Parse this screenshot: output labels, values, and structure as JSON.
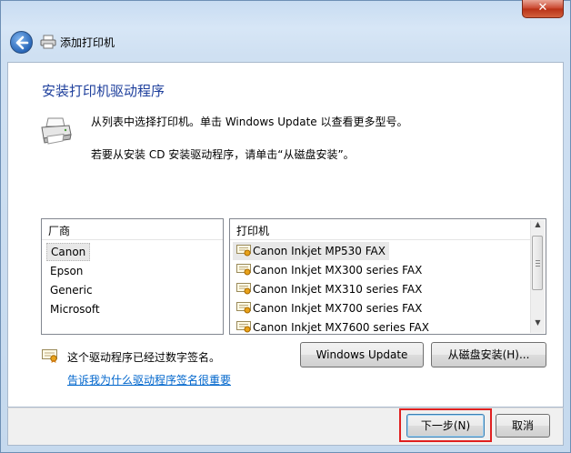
{
  "window": {
    "close_glyph": "✕",
    "title": "添加打印机"
  },
  "heading": "安装打印机驱动程序",
  "description": {
    "line1": "从列表中选择打印机。单击 Windows Update 以查看更多型号。",
    "line2": "若要从安装 CD 安装驱动程序，请单击“从磁盘安装”。"
  },
  "vendors": {
    "header": "厂商",
    "items": [
      {
        "label": "Canon",
        "selected": true
      },
      {
        "label": "Epson",
        "selected": false
      },
      {
        "label": "Generic",
        "selected": false
      },
      {
        "label": "Microsoft",
        "selected": false
      }
    ]
  },
  "printers": {
    "header": "打印机",
    "items": [
      {
        "label": "Canon Inkjet MP530 FAX",
        "selected": true
      },
      {
        "label": "Canon Inkjet MX300 series FAX",
        "selected": false
      },
      {
        "label": "Canon Inkjet MX310 series FAX",
        "selected": false
      },
      {
        "label": "Canon Inkjet MX700 series FAX",
        "selected": false
      },
      {
        "label": "Canon Inkjet MX7600 series FAX",
        "selected": false
      }
    ]
  },
  "buttons": {
    "windows_update": "Windows Update",
    "have_disk": "从磁盘安装(H)...",
    "next": "下一步(N)",
    "cancel": "取消"
  },
  "signature": {
    "status": "这个驱动程序已经过数字签名。",
    "link": "告诉我为什么驱动程序签名很重要"
  },
  "colors": {
    "heading": "#1e3f9c",
    "link": "#0066cc",
    "highlight": "#e02020"
  }
}
